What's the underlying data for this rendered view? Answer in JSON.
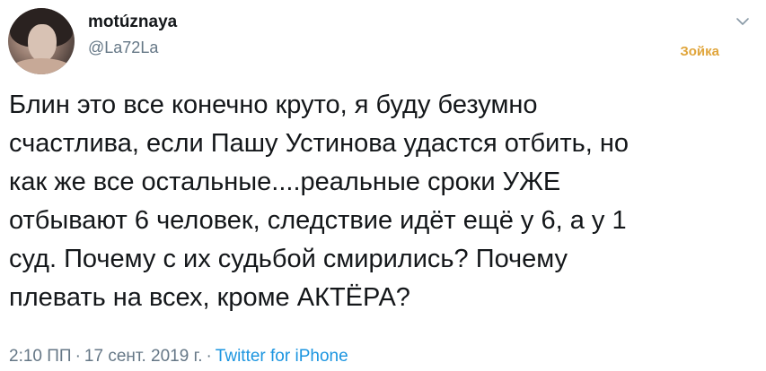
{
  "author": {
    "name": "motúznaya",
    "handle": "@La72La"
  },
  "header": {
    "follow_label": "Зойка",
    "follow_color": "#e0a53b",
    "more_icon": "chevron-down-icon"
  },
  "tweet": {
    "text": "Блин это все конечно круто, я буду безумно\nсчастлива, если Пашу Устинова удастся отбить, но\nкак же все остальные....реальные сроки УЖЕ\nотбывают 6 человек, следствие идёт ещё у 6, а у 1\nсуд. Почему с их судьбой смирились? Почему\nплевать на всех, кроме АКТЁРА?"
  },
  "meta": {
    "time": "2:10 ПП",
    "separator": "·",
    "date": "17 сент. 2019 г.",
    "source": "Twitter for iPhone",
    "source_color": "#1b95e0"
  }
}
